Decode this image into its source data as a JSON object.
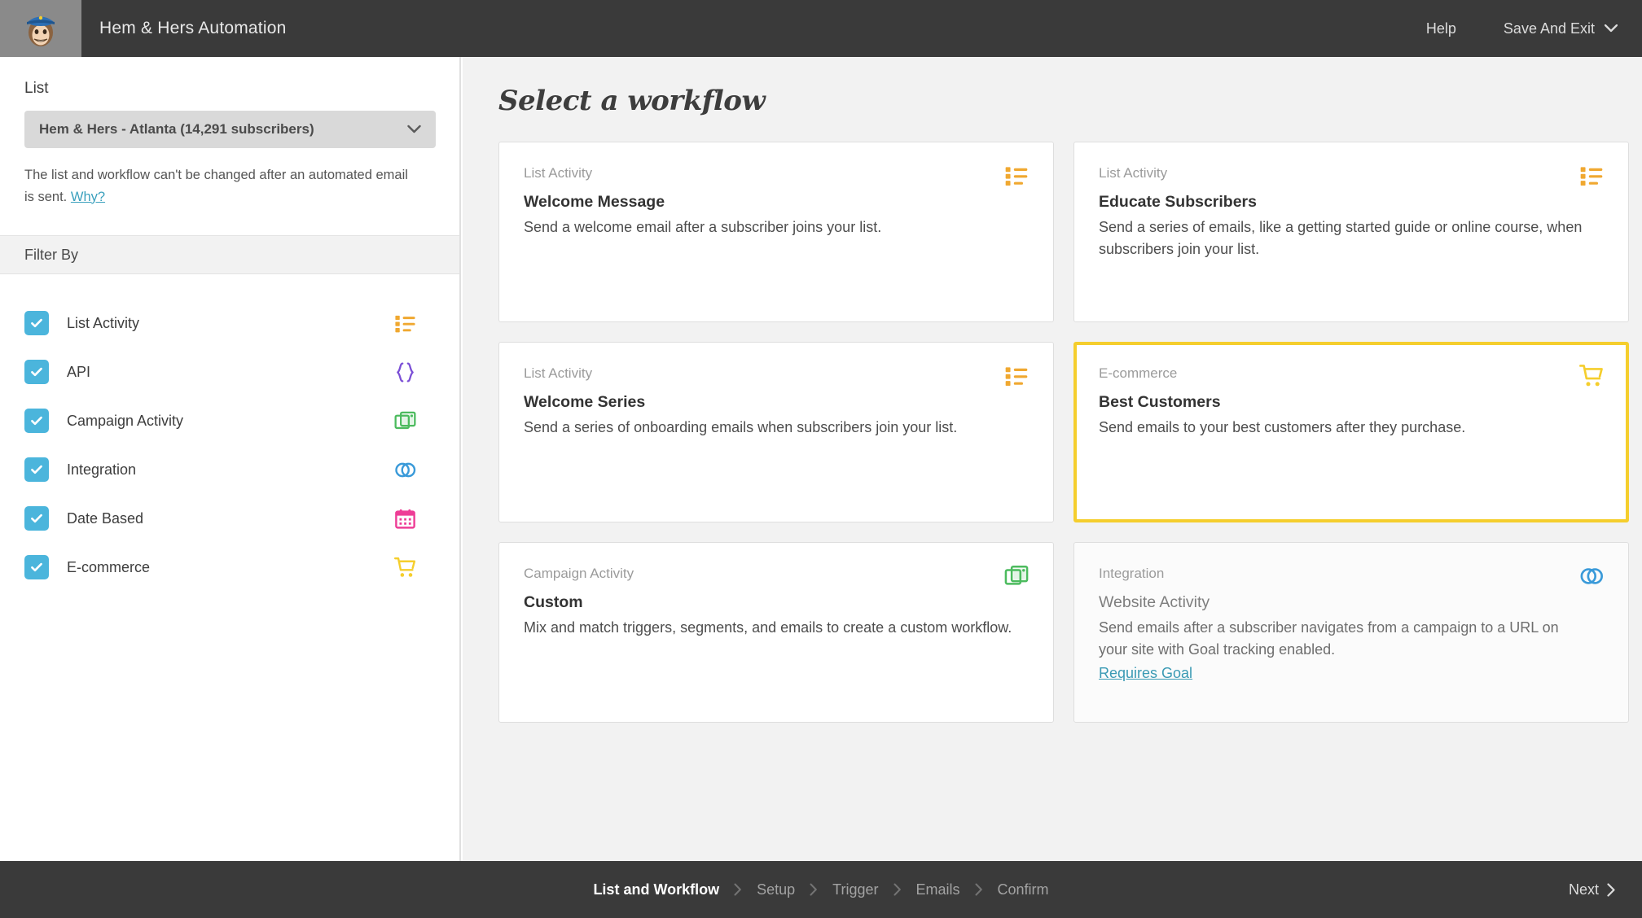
{
  "header": {
    "app_title": "Hem & Hers Automation",
    "help_label": "Help",
    "save_exit_label": "Save And Exit",
    "logo_icon": "mailchimp-freddie-icon",
    "chevron_icon": "chevron-down-icon"
  },
  "sidebar": {
    "list_label": "List",
    "list_select_value": "Hem & Hers - Atlanta (14,291 subscribers)",
    "helper_text": "The list and workflow can't be changed after an automated email is sent.",
    "helper_link": "Why?",
    "filter_heading": "Filter By",
    "filters": [
      {
        "label": "List Activity",
        "icon": "list-activity-icon",
        "color": "#F0A830",
        "checked": true
      },
      {
        "label": "API",
        "icon": "api-braces-icon",
        "color": "#7B4FD6",
        "checked": true
      },
      {
        "label": "Campaign Activity",
        "icon": "campaign-activity-icon",
        "color": "#4CBB5E",
        "checked": true
      },
      {
        "label": "Integration",
        "icon": "integration-rings-icon",
        "color": "#3A9AD9",
        "checked": true
      },
      {
        "label": "Date Based",
        "icon": "calendar-icon",
        "color": "#EE3D96",
        "checked": true
      },
      {
        "label": "E-commerce",
        "icon": "shopping-cart-icon",
        "color": "#F5CE2D",
        "checked": true
      }
    ]
  },
  "main": {
    "title": "Select a workflow",
    "cards": [
      {
        "category": "List Activity",
        "title": "Welcome Message",
        "description": "Send a welcome email after a subscriber joins your list.",
        "icon": "list-activity-icon",
        "icon_color": "#F0A830",
        "selected": false,
        "disabled": false,
        "link": ""
      },
      {
        "category": "List Activity",
        "title": "Educate Subscribers",
        "description": "Send a series of emails, like a getting started guide or online course, when subscribers join your list.",
        "icon": "list-activity-icon",
        "icon_color": "#F0A830",
        "selected": false,
        "disabled": false,
        "link": ""
      },
      {
        "category": "List Activity",
        "title": "Welcome Series",
        "description": "Send a series of onboarding emails when subscribers join your list.",
        "icon": "list-activity-icon",
        "icon_color": "#F0A830",
        "selected": false,
        "disabled": false,
        "link": ""
      },
      {
        "category": "E-commerce",
        "title": "Best Customers",
        "description": "Send emails to your best customers after they purchase.",
        "icon": "shopping-cart-icon",
        "icon_color": "#F5CE2D",
        "selected": true,
        "disabled": false,
        "link": ""
      },
      {
        "category": "Campaign Activity",
        "title": "Custom",
        "description": "Mix and match triggers, segments, and emails to create a custom workflow.",
        "icon": "campaign-activity-icon",
        "icon_color": "#4CBB5E",
        "selected": false,
        "disabled": false,
        "link": ""
      },
      {
        "category": "Integration",
        "title": "Website Activity",
        "description": "Send emails after a subscriber navigates from a campaign to a URL on your site with Goal tracking enabled.",
        "icon": "integration-rings-icon",
        "icon_color": "#3A9AD9",
        "selected": false,
        "disabled": true,
        "link": "Requires Goal"
      }
    ]
  },
  "footer": {
    "steps": [
      {
        "label": "List and Workflow",
        "active": true
      },
      {
        "label": "Setup",
        "active": false
      },
      {
        "label": "Trigger",
        "active": false
      },
      {
        "label": "Emails",
        "active": false
      },
      {
        "label": "Confirm",
        "active": false
      }
    ],
    "next_label": "Next",
    "separator_icon": "chevron-right-icon",
    "next_icon": "chevron-right-icon"
  },
  "colors": {
    "selection_border": "#F5CE2D",
    "checkbox": "#4BB5DC",
    "link": "#3A9AB4",
    "header_bg": "#3A3A3A",
    "main_bg": "#F2F2F2"
  }
}
